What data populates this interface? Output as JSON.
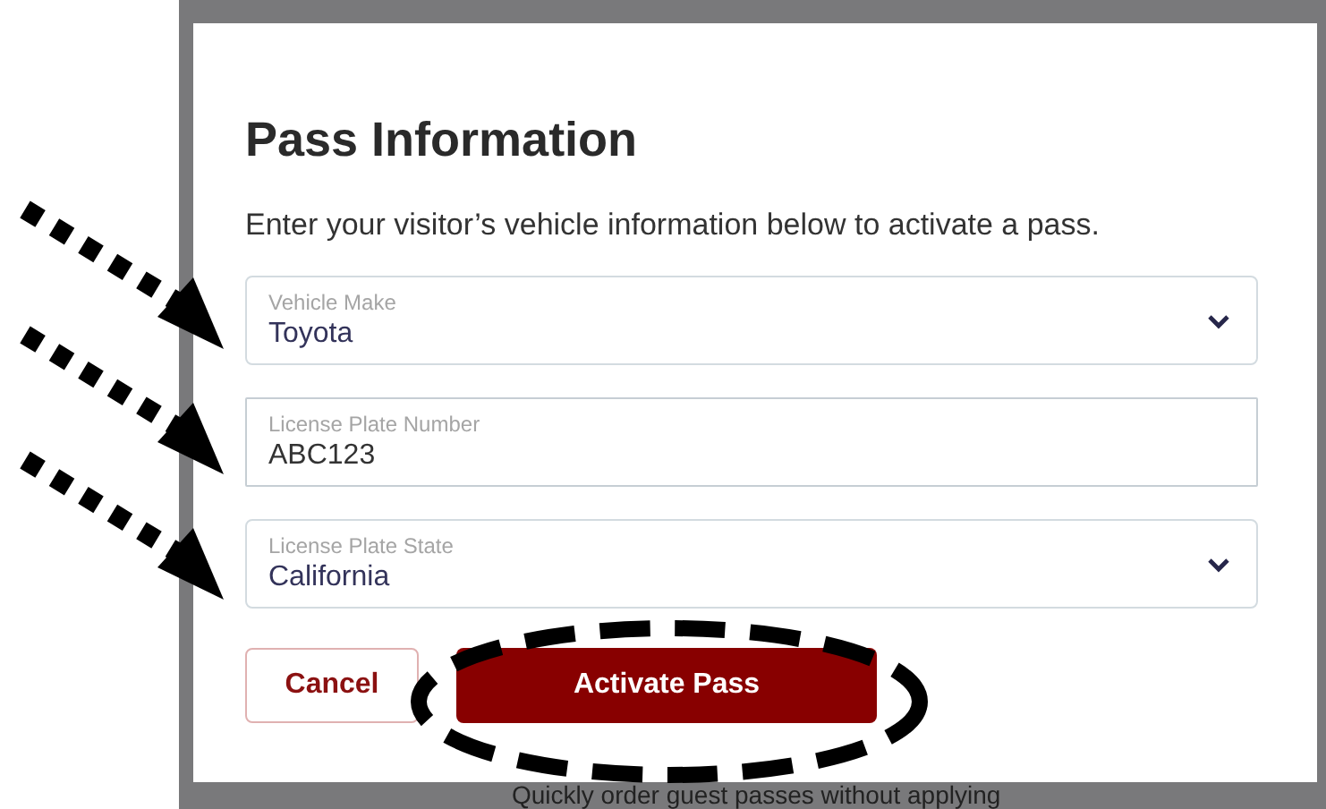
{
  "dialog": {
    "title": "Pass Information",
    "description": "Enter your visitor’s vehicle information below to activate a pass.",
    "fields": [
      {
        "kind": "select",
        "label": "Vehicle Make",
        "value": "Toyota"
      },
      {
        "kind": "text",
        "label": "License Plate Number",
        "value": "ABC123"
      },
      {
        "kind": "select",
        "label": "License Plate State",
        "value": "California"
      }
    ],
    "buttons": [
      {
        "kind": "secondary",
        "label": "Cancel"
      },
      {
        "kind": "primary",
        "label": "Activate Pass"
      }
    ]
  },
  "background_text": "Quickly order guest passes without applying"
}
